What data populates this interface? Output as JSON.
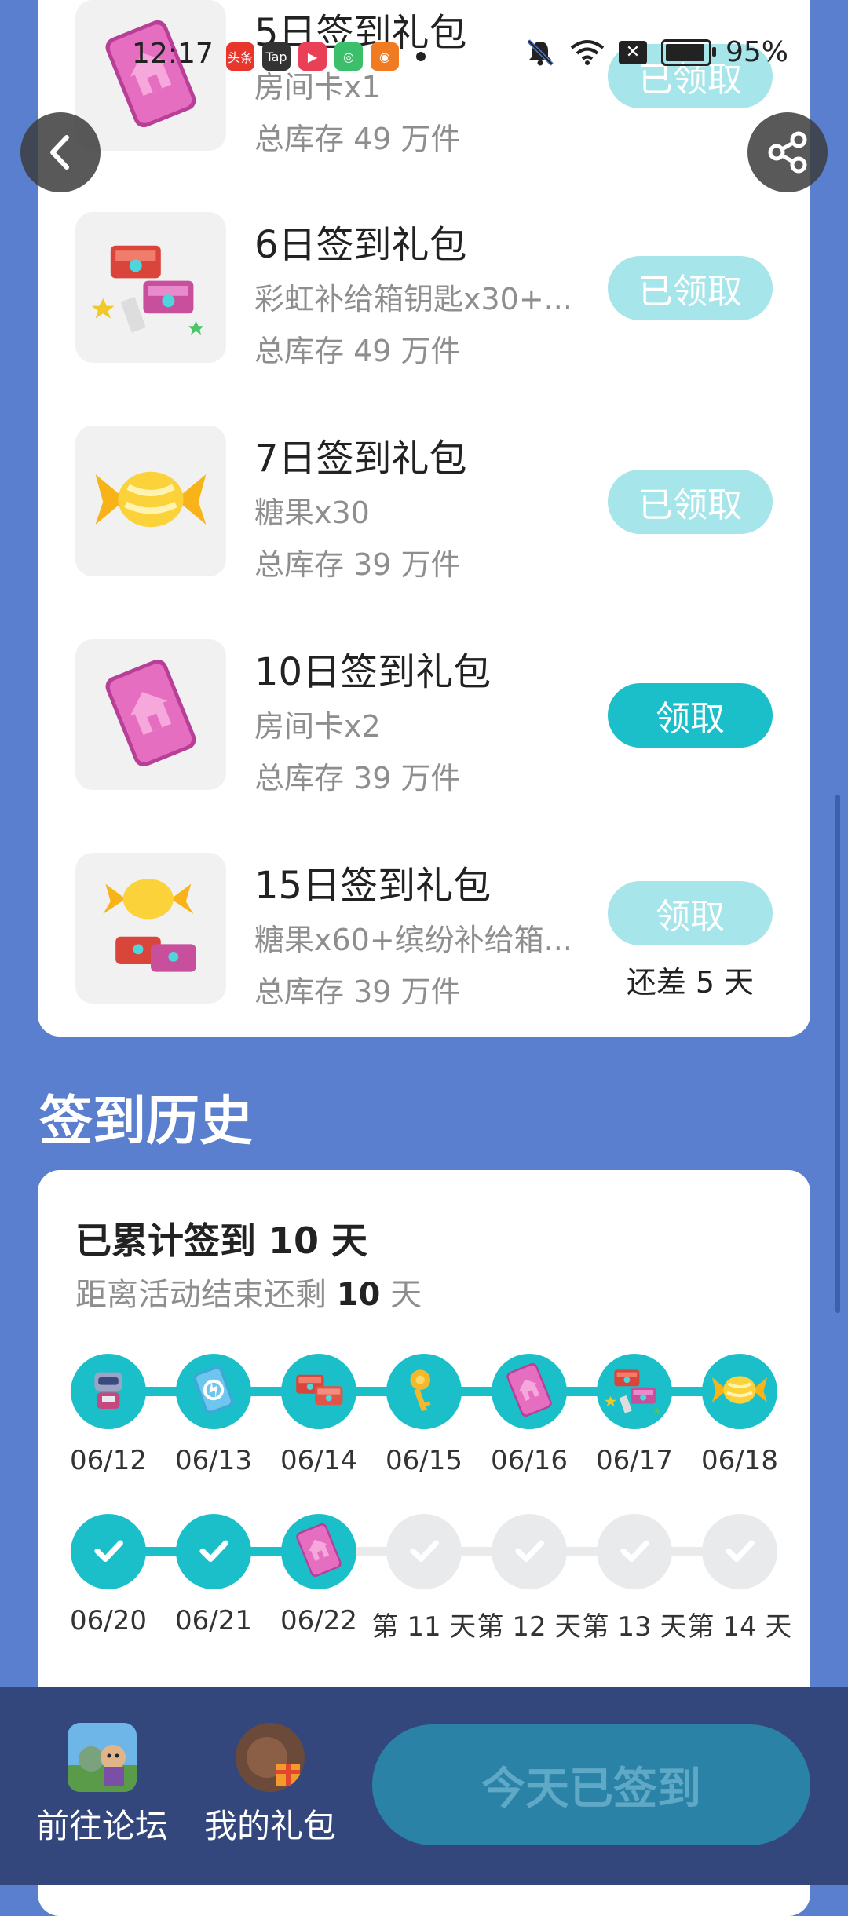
{
  "status_bar": {
    "time": "12:17",
    "app_icons": [
      {
        "name": "toutiao-app-icon",
        "text": "头条",
        "color": "#e8362d"
      },
      {
        "name": "tap-app-icon",
        "text": "Tap",
        "color": "#333333"
      },
      {
        "name": "video-app-icon",
        "text": "▶",
        "color": "#e94057"
      },
      {
        "name": "wechat-app-icon",
        "text": "◎",
        "color": "#3bbf6a"
      },
      {
        "name": "kuaishou-app-icon",
        "text": "◉",
        "color": "#f07b22"
      }
    ],
    "battery_percent": "95%",
    "battery_level": 0.95
  },
  "gifts": [
    {
      "title": "5日签到礼包",
      "desc": "房间卡x1",
      "stock": "总库存 49 万件",
      "status": "已领取",
      "state": "done",
      "icon": "room-card-icon"
    },
    {
      "title": "6日签到礼包",
      "desc": "彩虹补给箱钥匙x30+...",
      "stock": "总库存 49 万件",
      "status": "已领取",
      "state": "done",
      "icon": "supply-box-keys-icon"
    },
    {
      "title": "7日签到礼包",
      "desc": "糖果x30",
      "stock": "总库存 39 万件",
      "status": "已领取",
      "state": "done",
      "icon": "candy-icon"
    },
    {
      "title": "10日签到礼包",
      "desc": "房间卡x2",
      "stock": "总库存 39 万件",
      "status": "领取",
      "state": "active",
      "icon": "room-card-icon"
    },
    {
      "title": "15日签到礼包",
      "desc": "糖果x60+缤纷补给箱...",
      "stock": "总库存 39 万件",
      "status": "领取",
      "state": "wait",
      "note": "还差 5 天",
      "icon": "candy-and-box-icon"
    }
  ],
  "history": {
    "section_title": "签到历史",
    "total_prefix": "已累计签到 ",
    "total_days": "10",
    "total_suffix": " 天",
    "remaining_prefix": "距离活动结束还剩 ",
    "remaining_days": "10",
    "remaining_suffix": " 天",
    "row1": [
      {
        "label": "06/12",
        "icon": "robot-icon"
      },
      {
        "label": "06/13",
        "icon": "skill-card-icon"
      },
      {
        "label": "06/14",
        "icon": "supply-box-icon"
      },
      {
        "label": "06/15",
        "icon": "trophy-key-icon"
      },
      {
        "label": "06/16",
        "icon": "room-card-icon"
      },
      {
        "label": "06/17",
        "icon": "supply-box-keys-icon"
      },
      {
        "label": "06/18",
        "icon": "candy-icon"
      }
    ],
    "row2": [
      {
        "label": "06/20",
        "state": "done",
        "icon": "check-icon"
      },
      {
        "label": "06/21",
        "state": "done",
        "icon": "check-icon"
      },
      {
        "label": "06/22",
        "state": "done",
        "icon": "room-card-icon"
      },
      {
        "label": "第 11 天",
        "state": "todo",
        "icon": "check-icon"
      },
      {
        "label": "第 12 天",
        "state": "todo",
        "icon": "check-icon"
      },
      {
        "label": "第 13 天",
        "state": "todo",
        "icon": "check-icon"
      },
      {
        "label": "第 14 天",
        "state": "todo",
        "icon": "check-icon"
      }
    ]
  },
  "bottom_bar": {
    "forum_label": "前往论坛",
    "gifts_label": "我的礼包",
    "checkin_label": "今天已签到"
  },
  "colors": {
    "page_bg": "#5b7fcf",
    "accent": "#1bbfc9",
    "accent_light": "#a6e5e9",
    "bottom_bar": "#34477c"
  }
}
